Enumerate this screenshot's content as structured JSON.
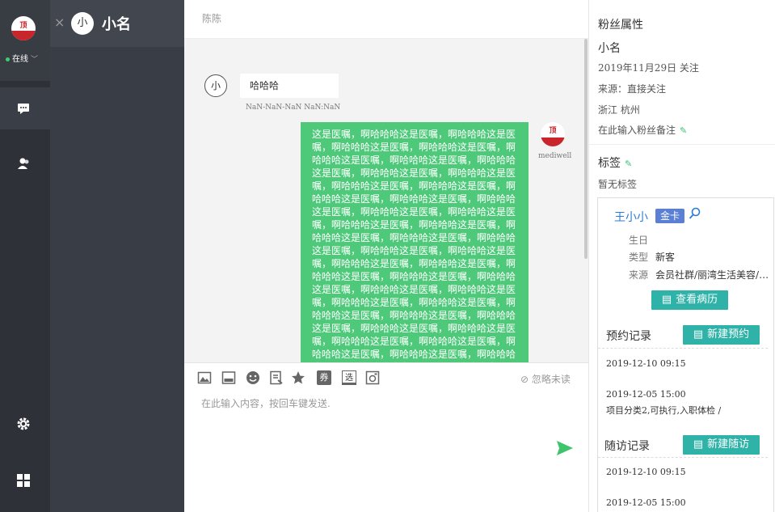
{
  "nav": {
    "logo_text": "顶",
    "status_label": "在线",
    "status_chevron": "﹀",
    "chat_icon": "chat-icon",
    "contacts_icon": "contacts-icon",
    "settings_icon": "gear-icon",
    "grid_icon": "grid-icon"
  },
  "contact": {
    "close": "×",
    "avatar": "小",
    "name": "小名"
  },
  "chat": {
    "title": "陈陈",
    "incoming": {
      "avatar": "小",
      "text": "哈哈哈",
      "time": "NaN-NaN-NaN NaN:NaN"
    },
    "outgoing": {
      "text": "这是医嘱，啊哈哈哈这是医嘱，啊哈哈哈这是医嘱，啊哈哈哈这是医嘱，啊哈哈哈这是医嘱，啊哈哈哈这是医嘱，啊哈哈哈这是医嘱，啊哈哈哈这是医嘱，啊哈哈哈这是医嘱，啊哈哈哈这是医嘱，啊哈哈哈这是医嘱，啊哈哈哈这是医嘱，啊哈哈哈这是医嘱，啊哈哈哈这是医嘱，啊哈哈哈这是医嘱，啊哈哈哈这是医嘱，啊哈哈哈这是医嘱，啊哈哈哈这是医嘱，啊哈哈哈这是医嘱，啊哈哈哈这是医嘱，啊哈哈哈这是医嘱，啊哈哈哈这是医嘱，啊哈哈哈这是医嘱，啊哈哈哈这是医嘱，啊哈哈哈这是医嘱，啊哈哈哈这是医嘱，啊哈哈哈这是医嘱，啊哈哈哈这是医嘱，啊哈哈哈这是医嘱，啊哈哈哈这是医嘱，啊哈哈哈这是医嘱，啊哈哈哈这是医嘱，啊哈哈哈这是医嘱，啊哈哈哈这是医嘱，啊哈哈哈这是医嘱，啊哈哈哈这是医嘱，啊哈哈哈这是医嘱，啊哈哈哈这是医嘱，啊哈哈哈这是医嘱，啊哈哈哈这是医嘱，啊哈哈哈这是医嘱，啊哈哈哈这是医嘱，啊哈哈哈这是医嘱，啊哈哈哈这是医嘱，啊哈哈哈这是医嘱，啊哈哈哈这是医嘱，啊哈哈哈这是医嘱，啊哈哈哈这是医嘱，啊哈哈哈这是医嘱，啊哈哈哈这是医嘱，啊哈哈哈这是医嘱，啊哈哈哈这是医嘱，啊哈哈哈这是医嘱，啊哈哈哈这是医嘱，啊哈哈哈",
      "avatar_text": "顶",
      "sender": "mediwell"
    },
    "toolbar": {
      "image_icon": "image-icon",
      "screen_icon": "screen-icon",
      "emoji_icon": "emoji-icon",
      "doc_icon": "document-icon",
      "star_icon": "star-icon",
      "coupon_label": "券",
      "select_label": "选",
      "camera_icon": "camera-icon",
      "ignore_label": "忽略未读"
    },
    "input_placeholder": "在此输入内容，按回车键发送.",
    "send_icon": "send-icon"
  },
  "fan": {
    "title": "粉丝属性",
    "name": "小名",
    "followed": "2019年11月29日 关注",
    "source": "来源：直接关注",
    "location": "浙江 杭州",
    "note_placeholder": "在此输入粉丝备注",
    "tags_title": "标签",
    "tags_empty": "暂无标签"
  },
  "member": {
    "name": "王小小",
    "level": "金卡",
    "fields": [
      {
        "key": "生日",
        "value": ""
      },
      {
        "key": "类型",
        "value": "新客"
      },
      {
        "key": "来源",
        "value": "会员社群/丽湾生活美容/6..."
      }
    ],
    "view_records": "查看病历",
    "appointments_title": "预约记录",
    "new_appointment": "新建预约",
    "appointments": [
      {
        "time": "2019-12-10 09:15",
        "detail": ""
      },
      {
        "time": "2019-12-05 15:00",
        "detail": "项目分类2,可执行,入职体检 /"
      }
    ],
    "followups_title": "随访记录",
    "new_followup": "新建随访",
    "followups": [
      {
        "time": "2019-12-10 09:15"
      },
      {
        "time": "2019-12-05 15:00"
      }
    ],
    "colors": {
      "accent": "#2fb3a8",
      "bubble": "#4ec97a",
      "badge": "#5b7fd4"
    }
  }
}
